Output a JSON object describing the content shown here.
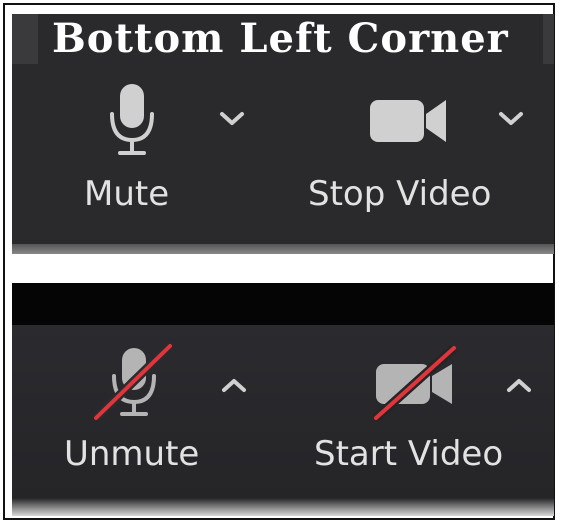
{
  "header": {
    "title": "Bottom Left Corner"
  },
  "active_bar": {
    "mute_label": "Mute",
    "video_label": "Stop Video"
  },
  "inactive_bar": {
    "unmute_label": "Unmute",
    "video_label": "Start Video"
  },
  "colors": {
    "bar_background": "#2a2a2d",
    "icon": "#d0d0d0",
    "icon_dim": "#b4b4b4",
    "slash": "#e0353a",
    "label": "#e2e2e2"
  },
  "icons": [
    "microphone-icon",
    "chevron-down-icon",
    "video-camera-icon",
    "muted-microphone-icon",
    "chevron-up-icon",
    "video-off-icon"
  ]
}
